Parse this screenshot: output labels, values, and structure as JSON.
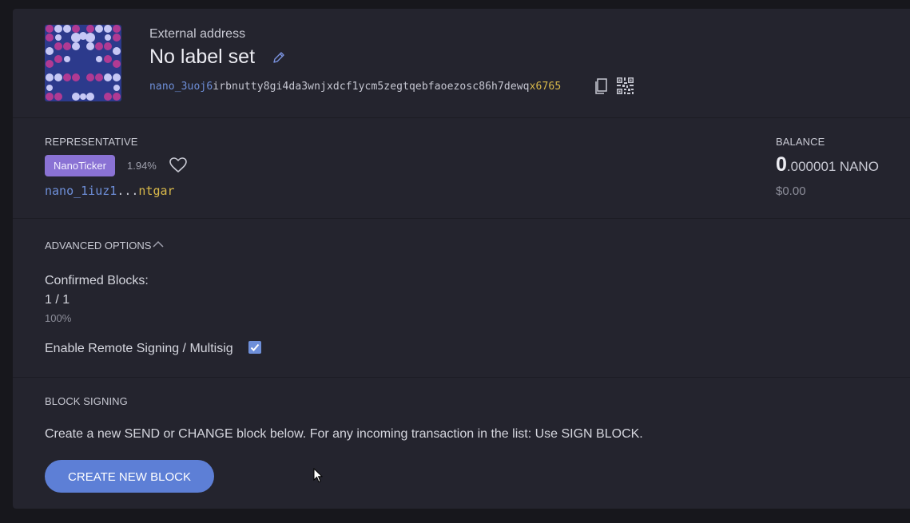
{
  "header": {
    "account_type": "External address",
    "label": "No label set",
    "address_prefix": "nano_3uoj6",
    "address_middle": "irbnutty8gi4da3wnjxdcf1ycm5zegtqebfaoezosc86h7dewq",
    "address_suffix": "x6765"
  },
  "representative": {
    "label": "REPRESENTATIVE",
    "name": "NanoTicker",
    "weight": "1.94%",
    "addr_prefix": "nano_1iuz1",
    "addr_ellipsis": "...",
    "addr_suffix": "ntgar"
  },
  "balance": {
    "label": "BALANCE",
    "integer": "0",
    "decimal": ".000001",
    "unit": "NANO",
    "fiat": "$0.00"
  },
  "advanced": {
    "toggle_label": "ADVANCED OPTIONS",
    "confirmed_label": "Confirmed Blocks:",
    "confirmed_value": "1 / 1",
    "confirmed_pct": "100%",
    "remote_signing_label": "Enable Remote Signing / Multisig",
    "remote_signing_checked": true
  },
  "block_signing": {
    "label": "BLOCK SIGNING",
    "description": "Create a new SEND or CHANGE block below. For any incoming transaction in the list: Use SIGN BLOCK.",
    "button_label": "CREATE NEW BLOCK"
  },
  "colors": {
    "background": "#17171c",
    "card": "#24242e",
    "accent_blue": "#5d7fd6",
    "accent_purple": "#8a72d4",
    "address_gold": "#d9b94a"
  },
  "icons": {
    "edit": "pencil-icon",
    "copy": "copy-icon",
    "qr": "qr-code-icon",
    "favorite": "heart-icon",
    "toggle": "chevron-up-icon",
    "checkbox": "check-icon"
  }
}
